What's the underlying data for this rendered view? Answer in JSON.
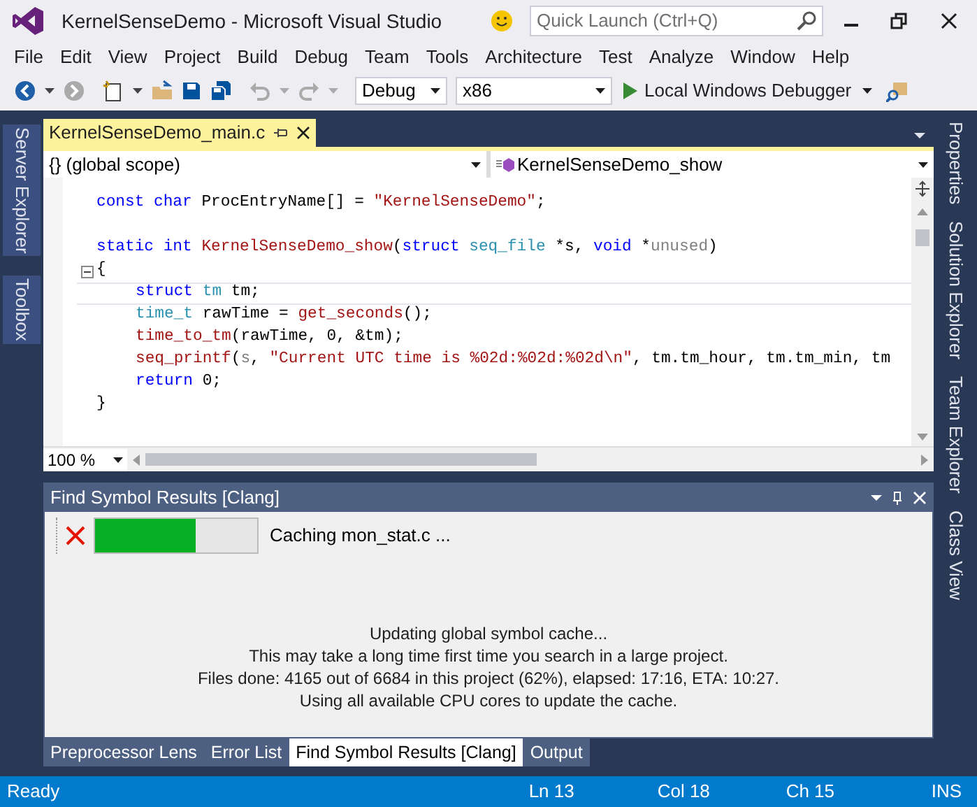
{
  "window": {
    "title": "KernelSenseDemo - Microsoft Visual Studio"
  },
  "quick_launch": {
    "placeholder": "Quick Launch (Ctrl+Q)"
  },
  "menu": [
    "File",
    "Edit",
    "View",
    "Project",
    "Build",
    "Debug",
    "Team",
    "Tools",
    "Architecture",
    "Test",
    "Analyze",
    "Window",
    "Help"
  ],
  "toolbar": {
    "configuration": "Debug",
    "platform": "x86",
    "start": "Local Windows Debugger"
  },
  "left_tabs": [
    "Server Explorer",
    "Toolbox"
  ],
  "right_tabs": [
    "Properties",
    "Solution Explorer",
    "Team Explorer",
    "Class View"
  ],
  "document_tabs": [
    {
      "label": "KernelSenseDemo_main.c",
      "selected": true
    }
  ],
  "navigation": {
    "scope": "{} (global scope)",
    "member": "KernelSenseDemo_show"
  },
  "code": [
    {
      "fold": false,
      "indented": false,
      "tokens": [
        {
          "kind": "keyword",
          "text": "const char "
        },
        {
          "kind": "plain",
          "text": "ProcEntryName[] = "
        },
        {
          "kind": "string",
          "text": "\"KernelSenseDemo\""
        },
        {
          "kind": "plain",
          "text": ";"
        }
      ]
    },
    {
      "fold": false
    },
    {
      "fold": false,
      "indented": false,
      "tokens": [
        {
          "kind": "keyword",
          "text": "static int "
        },
        {
          "kind": "func",
          "text": "KernelSenseDemo_show"
        },
        {
          "kind": "plain",
          "text": "("
        },
        {
          "kind": "keyword",
          "text": "struct "
        },
        {
          "kind": "type",
          "text": "seq_file"
        },
        {
          "kind": "plain",
          "text": " *s, "
        },
        {
          "kind": "keyword",
          "text": "void"
        },
        {
          "kind": "plain",
          "text": " *"
        },
        {
          "kind": "param",
          "text": "unused"
        },
        {
          "kind": "plain",
          "text": ")"
        }
      ]
    },
    {
      "fold": true,
      "indented": false,
      "tokens": [
        {
          "kind": "plain",
          "text": "{"
        }
      ]
    },
    {
      "fold": false,
      "indented": true,
      "tokens": [
        {
          "kind": "keyword",
          "text": "struct "
        },
        {
          "kind": "type",
          "text": "tm"
        },
        {
          "kind": "plain",
          "text": " tm;"
        }
      ]
    },
    {
      "fold": false,
      "indented": true,
      "tokens": [
        {
          "kind": "type",
          "text": "time_t"
        },
        {
          "kind": "plain",
          "text": " rawTime = "
        },
        {
          "kind": "func",
          "text": "get_seconds"
        },
        {
          "kind": "plain",
          "text": "();"
        }
      ]
    },
    {
      "fold": false,
      "indented": true,
      "tokens": [
        {
          "kind": "func",
          "text": "time_to_tm"
        },
        {
          "kind": "plain",
          "text": "(rawTime, 0, &tm);"
        }
      ]
    },
    {
      "fold": false,
      "indented": true,
      "tokens": [
        {
          "kind": "func",
          "text": "seq_printf"
        },
        {
          "kind": "plain",
          "text": "("
        },
        {
          "kind": "param",
          "text": "s"
        },
        {
          "kind": "plain",
          "text": ", "
        },
        {
          "kind": "string",
          "text": "\"Current UTC time is %02d:%02d:%02d\\n\""
        },
        {
          "kind": "plain",
          "text": ", tm.tm_hour, tm.tm_min, tm"
        }
      ]
    },
    {
      "fold": false,
      "indented": true,
      "tokens": [
        {
          "kind": "keyword",
          "text": "return"
        },
        {
          "kind": "plain",
          "text": " 0;"
        }
      ]
    },
    {
      "fold": false,
      "indented": false,
      "tokens": [
        {
          "kind": "plain",
          "text": "}"
        }
      ]
    }
  ],
  "zoom": "100 %",
  "tool_window": {
    "title": "Find Symbol Results [Clang]",
    "progress": {
      "level": 0.62,
      "status": "Caching mon_stat.c ..."
    },
    "message": [
      "Updating global symbol cache...",
      "This may take a long time first time you search in a large project.",
      "Files done: 4165 out of 6684 in this project (62%), elapsed: 17:16, ETA: 10:27.",
      "Using all available CPU cores to update the cache."
    ]
  },
  "bottom_tabs": [
    {
      "label": "Preprocessor Lens",
      "selected": false
    },
    {
      "label": "Error List",
      "selected": false
    },
    {
      "label": "Find Symbol Results [Clang]",
      "selected": true
    },
    {
      "label": "Output",
      "selected": false
    }
  ],
  "status_bar": {
    "state": "Ready",
    "line": "Ln 13",
    "column": "Col 18",
    "char": "Ch 15",
    "mode": "INS"
  }
}
